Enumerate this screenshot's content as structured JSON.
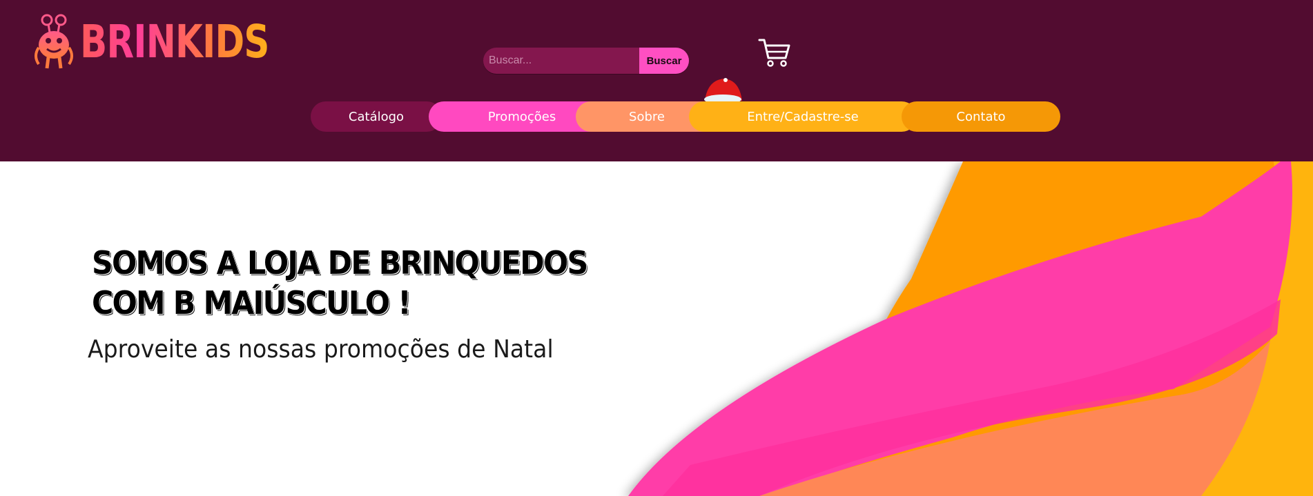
{
  "brand": {
    "name": "BRINKIDS"
  },
  "search": {
    "placeholder": "Buscar...",
    "button_label": "Buscar"
  },
  "nav": {
    "items": [
      {
        "label": "Catálogo",
        "color": "#7a1045"
      },
      {
        "label": "Promoções",
        "color": "#ff49c0"
      },
      {
        "label": "Sobre",
        "color": "#ff9566"
      },
      {
        "label": "Entre/Cadastre-se",
        "color": "#ffb116"
      },
      {
        "label": "Contato",
        "color": "#f59806"
      }
    ]
  },
  "hero": {
    "title_line1": "SOMOS A LOJA DE BRINQUEDOS",
    "title_line2": "COM B MAIÚSCULO !",
    "subtitle": "Aproveite as nossas promoções de Natal"
  },
  "colors": {
    "header_bg": "#520c30",
    "search_bg": "#84174e",
    "search_button": "#ff4fc2",
    "wave_pink": "#ff3da8",
    "wave_orange": "#ff9a00",
    "wave_yellow": "#ffb411",
    "wave_salmon": "#ff8757"
  },
  "icons": {
    "cart": "cart-icon",
    "santa_hat": "santa-hat-icon",
    "logo_mascot": "monster-mascot-icon"
  }
}
